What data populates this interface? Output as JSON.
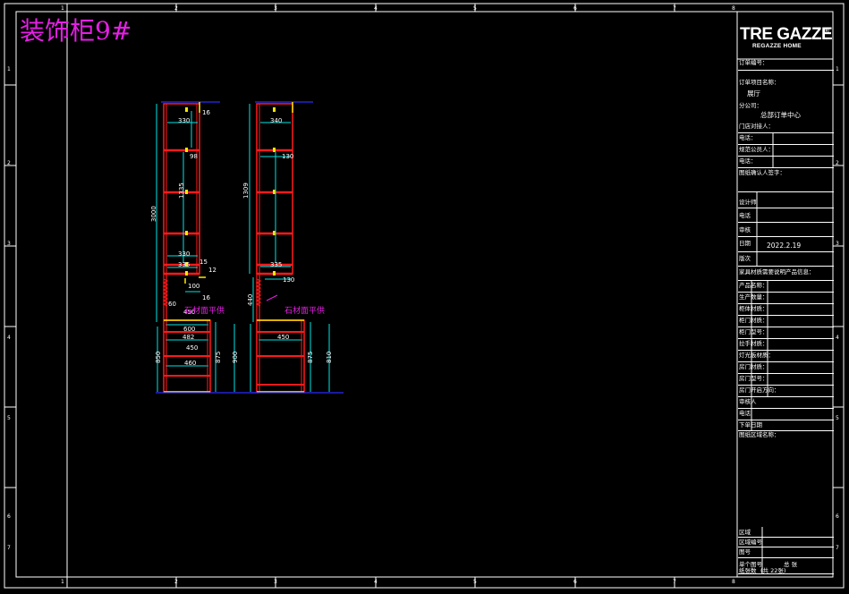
{
  "drawing_title": "装饰柜9#",
  "logo": {
    "main": "TRE GAZZE",
    "sub": "REGAZZE HOME",
    "reg": "®"
  },
  "title_block": {
    "order_no_label": "订单编号：",
    "project_label": "订单项目名称：",
    "project_value": "展厅",
    "company_label": "分公司：",
    "company_value": "总部订单中心",
    "store_contact_label": "门店对接人：",
    "phone_label_1": "电话：",
    "design_staff_label": "规范公员人：",
    "phone_label_2": "电话：",
    "confirm_sign_label": "图纸确认人签字：",
    "designer_label": "设计师",
    "phone_label_3": "电话",
    "reviewer_label": "审核",
    "date_label": "日期",
    "date_value": "2022.2.19",
    "version_label": "版次",
    "note_label": "家具材质需要说明产品信息：",
    "product_name_label": "产品名称：",
    "quantity_label": "生产数量：",
    "body_material_label": "柜体材质：",
    "door_material_label": "柜门材质：",
    "door_model_label": "柜门型号：",
    "handle_material_label": "拉手材质：",
    "backlight_label": "灯光板材质：",
    "room_door_material_label": "房门材质：",
    "room_door_model_label": "房门型号：",
    "room_door_direction_label": "房门开启方向：",
    "reviewer2_label": "审核人",
    "phone_label_4": "电话",
    "order_date_label": "下单日期",
    "drawing_name_label": "图纸区域名称：",
    "area_label": "区域",
    "area_no_label": "区域编号",
    "sheet_no_label": "图号",
    "total_sheets_label": "单个图号",
    "sheet_count_label": "纸张数",
    "sheet_count_value": "总 张",
    "total_value": "(共 22张)"
  },
  "cabinet_left": {
    "dims": [
      "16",
      "330",
      "98",
      "1335",
      "3000",
      "330",
      "15",
      "335",
      "12",
      "100",
      "16",
      "60",
      "450",
      "600",
      "482",
      "450",
      "850",
      "460",
      "875"
    ],
    "note": "石材面平供"
  },
  "cabinet_right": {
    "dims": [
      "340",
      "130",
      "1309",
      "335",
      "130",
      "440",
      "450",
      "900",
      "875",
      "810"
    ],
    "note": "石材面平供"
  },
  "border_ticks": {
    "top": [
      "1",
      "2",
      "3",
      "4",
      "5",
      "6",
      "7",
      "8"
    ],
    "side": [
      "1",
      "2",
      "3",
      "4",
      "5",
      "6",
      "7"
    ]
  },
  "colors": {
    "red": "#ff1a1a",
    "cyan": "#00e5e5",
    "yellow": "#ffe600",
    "magenta": "#e61fe6",
    "blue": "#2a2aff",
    "white": "#ffffff"
  }
}
